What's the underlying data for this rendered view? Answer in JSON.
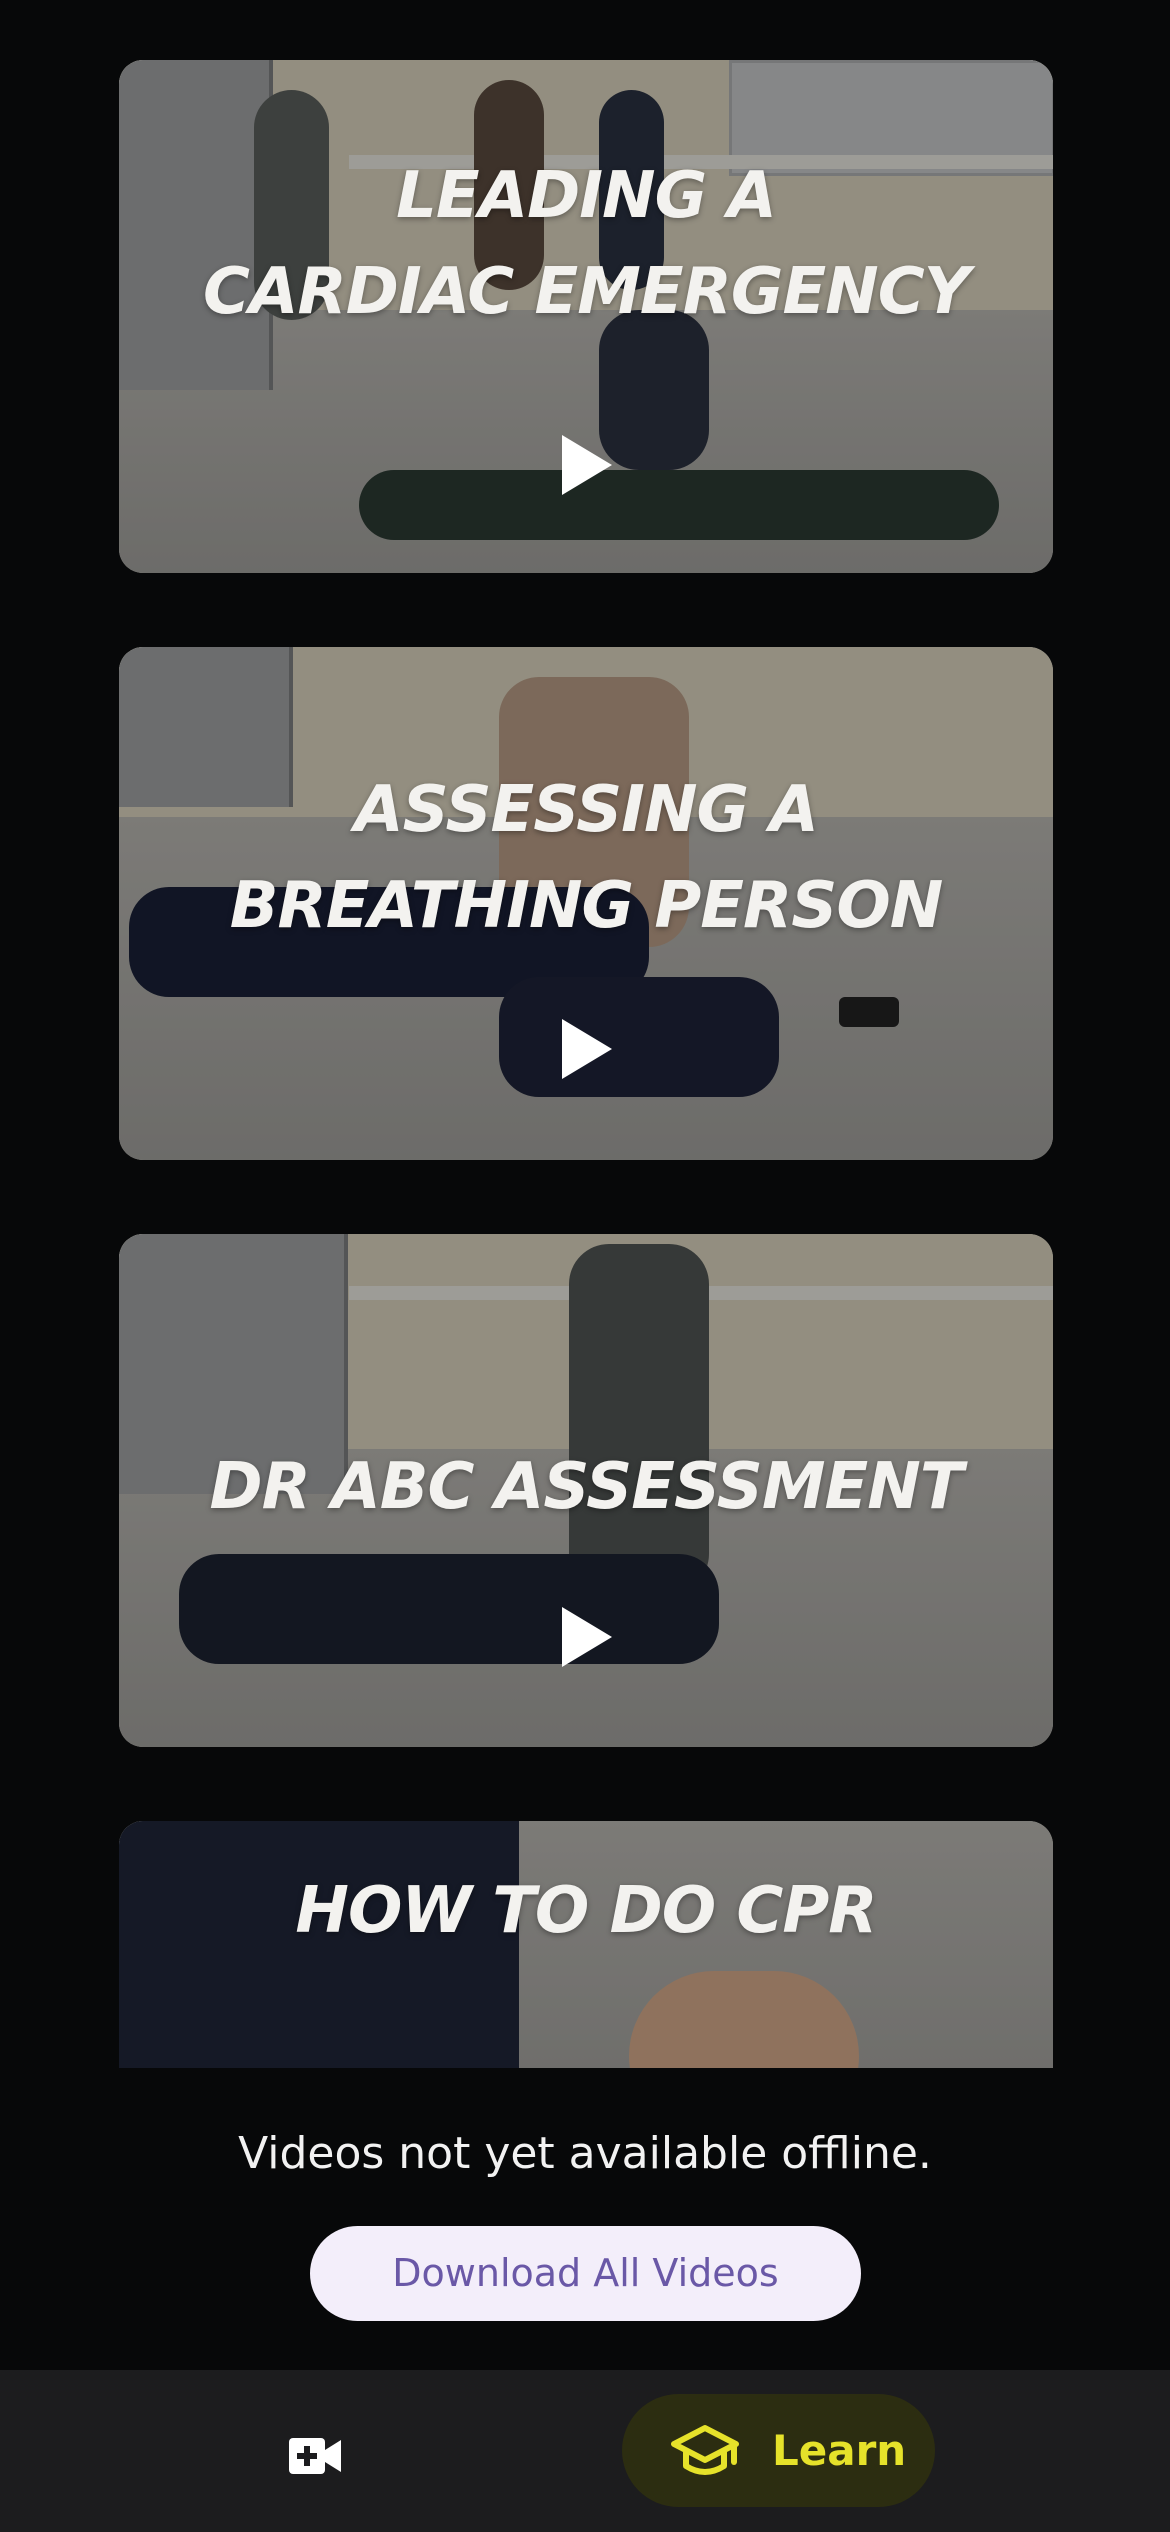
{
  "videos": [
    {
      "title": "LEADING A\nCARDIAC EMERGENCY",
      "play_icon": "play-icon"
    },
    {
      "title": "ASSESSING A\nBREATHING PERSON",
      "play_icon": "play-icon"
    },
    {
      "title": "DR ABC ASSESSMENT",
      "play_icon": "play-icon"
    },
    {
      "title": "HOW TO DO CPR",
      "play_icon": "play-icon"
    }
  ],
  "offline": {
    "message": "Videos not yet available offline.",
    "download_label": "Download All Videos"
  },
  "nav": {
    "videos_icon": "video-add-icon",
    "learn_icon": "graduation-cap-icon",
    "learn_label": "Learn",
    "colors": {
      "background": "#1c1c1e",
      "active_pill": "#2c2d11",
      "active_accent": "#e6e22a"
    }
  },
  "colors": {
    "page_background": "#070809",
    "button_background": "#f3eefa",
    "button_text": "#6a58a7"
  }
}
